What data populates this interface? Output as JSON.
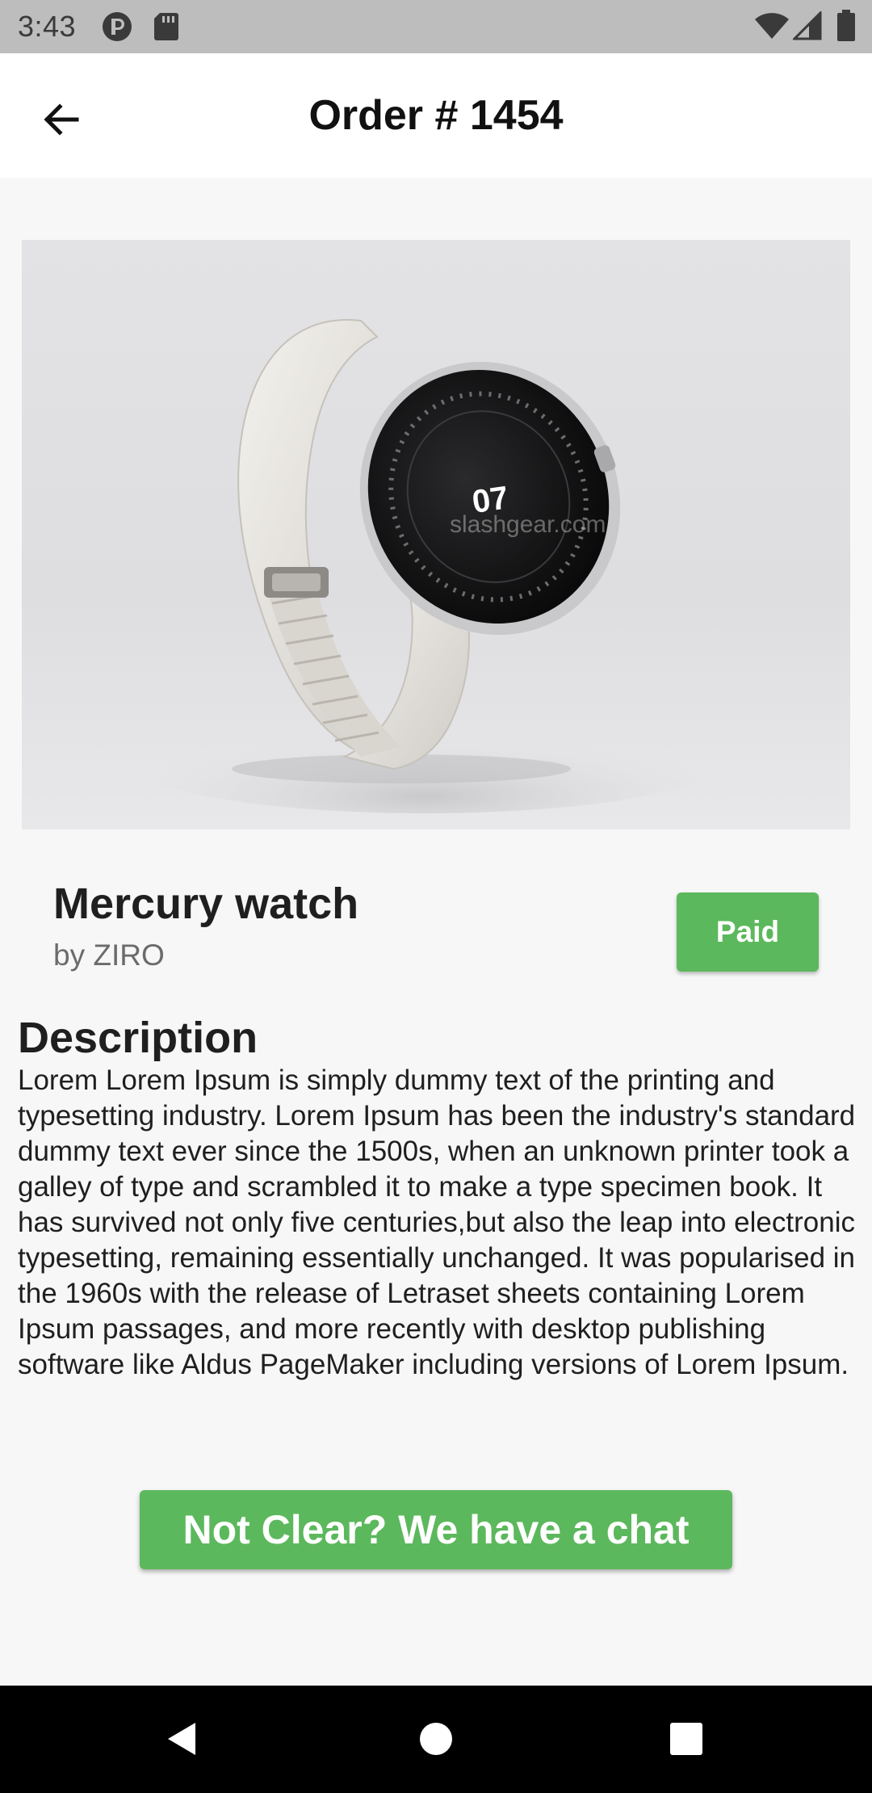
{
  "status_bar": {
    "time": "3:43",
    "icons": [
      "notification-icon",
      "sd-card-icon",
      "wifi-icon",
      "signal-icon",
      "battery-icon"
    ]
  },
  "app_bar": {
    "title": "Order # 1454",
    "back_icon": "arrow-left-icon"
  },
  "product": {
    "image_icon": "smartwatch-image",
    "image_watermark": "slashgear.com",
    "watch_face_text": "07",
    "name": "Mercury watch",
    "vendor": "by ZIRO",
    "status": "Paid"
  },
  "description": {
    "heading": "Description",
    "body": "Lorem Lorem Ipsum is simply dummy text of the printing and typesetting industry. Lorem Ipsum has been the industry's standard dummy text ever since the 1500s, when an unknown printer took a galley of type and scrambled it to make a type specimen book. It has survived not only five centuries,but also the leap into electronic typesetting, remaining essentially unchanged. It was popularised in the 1960s with the release of Letraset sheets containing Lorem Ipsum passages, and more recently with desktop publishing software like Aldus PageMaker including versions of Lorem Ipsum."
  },
  "actions": {
    "chat_label": "Not Clear? We have a chat"
  },
  "nav_bar": {
    "icons": [
      "nav-back-icon",
      "nav-home-icon",
      "nav-recents-icon"
    ]
  },
  "colors": {
    "accent_green": "#5cb85c",
    "status_bar": "#bdbdbd",
    "background": "#f7f7f7",
    "app_bar": "#ffffff",
    "nav_bar": "#000000"
  }
}
